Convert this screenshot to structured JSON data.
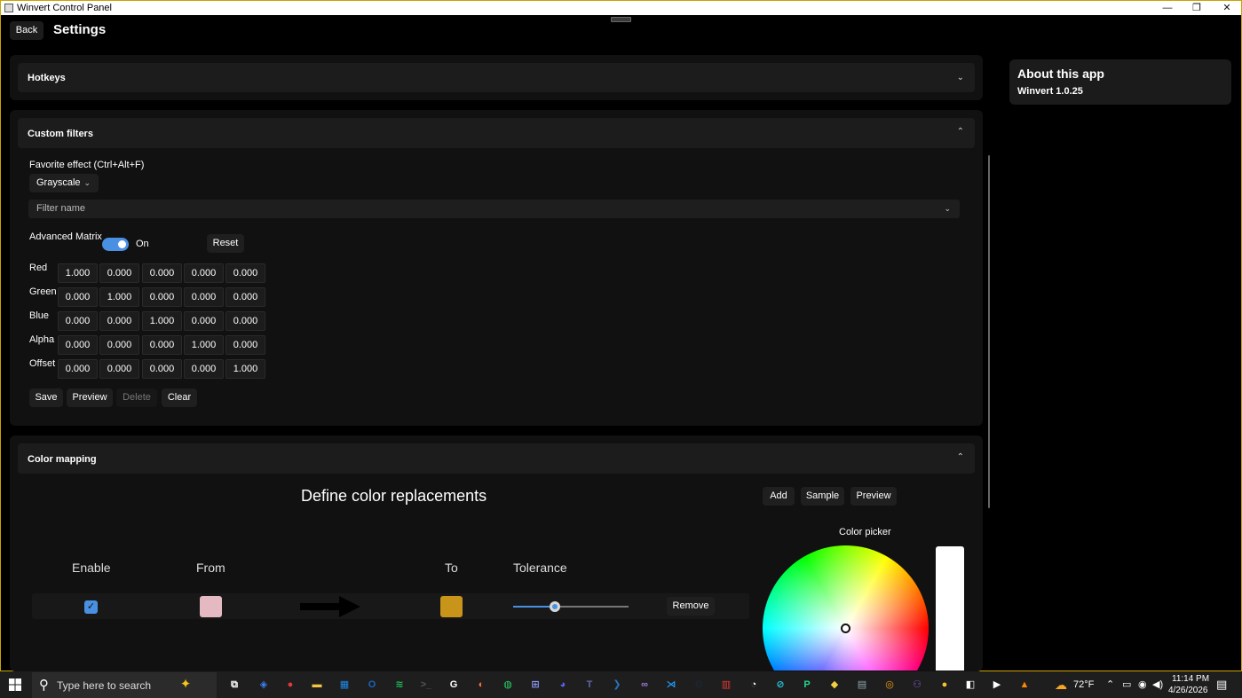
{
  "window": {
    "title": "Winvert Control Panel",
    "minimize_glyph": "—",
    "restore_glyph": "❐",
    "close_glyph": "✕"
  },
  "header": {
    "back_label": "Back",
    "title": "Settings"
  },
  "about": {
    "title": "About this app",
    "version": "Winvert 1.0.25"
  },
  "hotkeys": {
    "title": "Hotkeys",
    "expanded": false
  },
  "custom_filters": {
    "title": "Custom filters",
    "favorite_label": "Favorite effect (Ctrl+Alt+F)",
    "favorite_value": "Grayscale",
    "filter_name_placeholder": "Filter name",
    "advanced_matrix_label": "Advanced Matrix",
    "toggle_state": "On",
    "reset_label": "Reset",
    "rows": [
      {
        "label": "Red",
        "values": [
          "1.000",
          "0.000",
          "0.000",
          "0.000",
          "0.000"
        ]
      },
      {
        "label": "Green",
        "values": [
          "0.000",
          "1.000",
          "0.000",
          "0.000",
          "0.000"
        ]
      },
      {
        "label": "Blue",
        "values": [
          "0.000",
          "0.000",
          "1.000",
          "0.000",
          "0.000"
        ]
      },
      {
        "label": "Alpha",
        "values": [
          "0.000",
          "0.000",
          "0.000",
          "1.000",
          "0.000"
        ]
      },
      {
        "label": "Offset",
        "values": [
          "0.000",
          "0.000",
          "0.000",
          "0.000",
          "1.000"
        ]
      }
    ],
    "buttons": {
      "save": "Save",
      "preview": "Preview",
      "delete": "Delete",
      "clear": "Clear"
    }
  },
  "color_mapping": {
    "title": "Color mapping",
    "heading": "Define color replacements",
    "add_label": "Add",
    "sample_label": "Sample",
    "preview_label": "Preview",
    "columns": {
      "enable": "Enable",
      "from": "From",
      "to": "To",
      "tolerance": "Tolerance"
    },
    "mappings": [
      {
        "enabled": true,
        "from_color": "#E4B9C1",
        "to_color": "#C8941A",
        "tolerance": 0.36,
        "remove_label": "Remove"
      }
    ],
    "color_picker_label": "Color picker"
  },
  "taskbar": {
    "search_placeholder": "Type here to search",
    "weather": "72°F",
    "time": "11:14 PM",
    "date": "4/26/2026"
  },
  "colors": {
    "accent": "#4A90E2",
    "frame": "#C8A400"
  }
}
